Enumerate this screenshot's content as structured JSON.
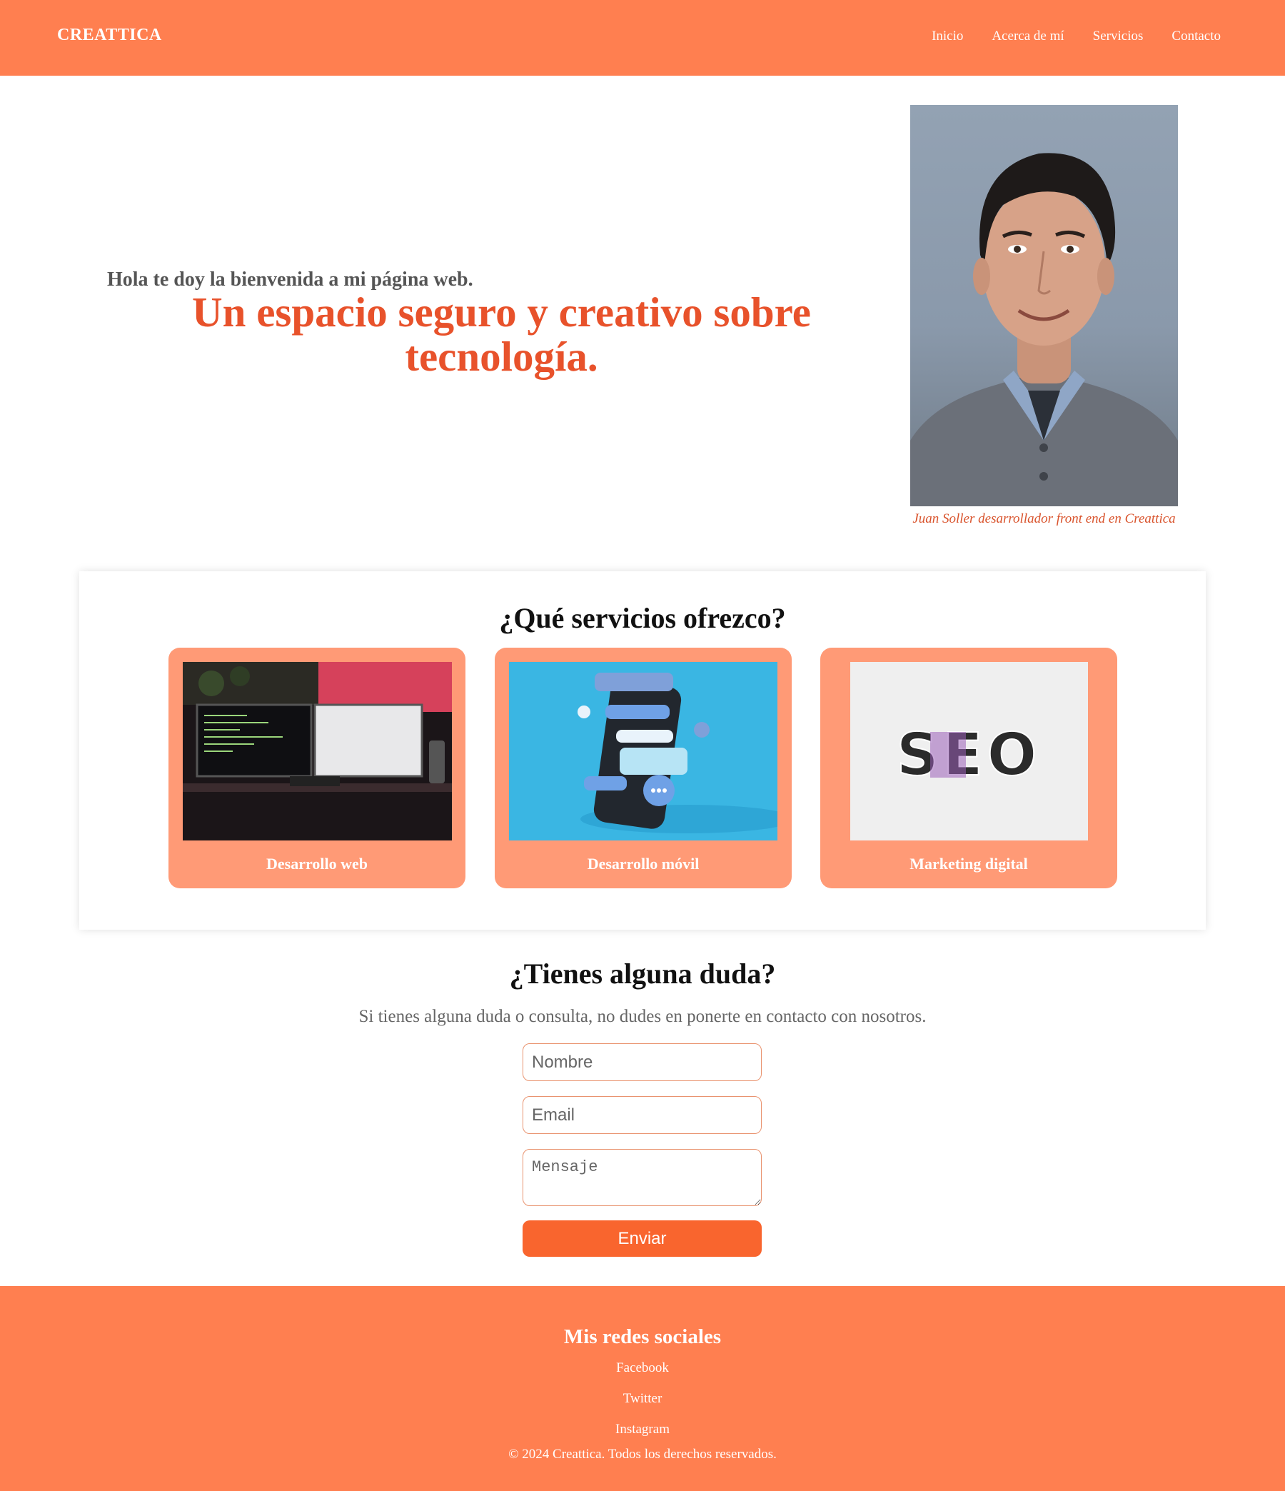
{
  "header": {
    "logo": "CREATTICA",
    "nav": [
      "Inicio",
      "Acerca de mí",
      "Servicios",
      "Contacto"
    ]
  },
  "hero": {
    "greeting": "Hola te doy la bienvenida a mi página web.",
    "title": "Un espacio seguro y creativo sobre tecnología.",
    "caption": "Juan Soller desarrollador front end en Creattica"
  },
  "services": {
    "title": "¿Qué servicios ofrezco?",
    "cards": [
      {
        "label": "Desarrollo web"
      },
      {
        "label": "Desarrollo móvil"
      },
      {
        "label": "Marketing digital"
      }
    ]
  },
  "contact": {
    "title": "¿Tienes alguna duda?",
    "text": "Si tienes alguna duda o consulta, no dudes en ponerte en contacto con nosotros.",
    "name_placeholder": "Nombre",
    "email_placeholder": "Email",
    "message_placeholder": "Mensaje",
    "submit_label": "Enviar"
  },
  "footer": {
    "title": "Mis redes sociales",
    "links": [
      "Facebook",
      "Twitter",
      "Instagram"
    ],
    "copyright": "© 2024 Creattica. Todos los derechos reservados."
  },
  "colors": {
    "brand": "#ff7f50",
    "card": "#ff9a76",
    "accent_title": "#e8522b",
    "button": "#f9652e"
  }
}
